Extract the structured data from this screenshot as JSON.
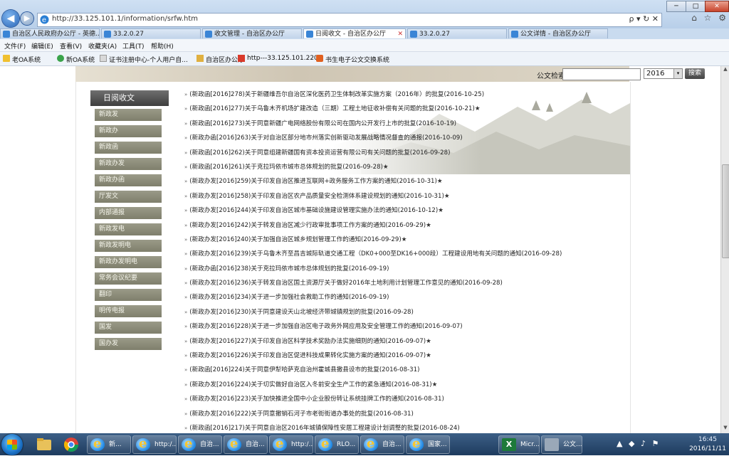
{
  "browser": {
    "address": "http://33.125.101.1/information/srfw.htm",
    "search_glyph": "ρ",
    "dropdown_glyph": "▾",
    "refresh_glyph": "↻",
    "stop_glyph": "✕",
    "back_glyph": "◀",
    "forward_glyph": "▶",
    "win_min": "─",
    "win_max": "□",
    "win_close": "✕",
    "icons": {
      "home": "⌂",
      "favorites": "☆",
      "tools": "⚙"
    }
  },
  "tabs": [
    {
      "label": "自治区人民政府办公厅 - 英德..."
    },
    {
      "label": "33.2.0.27"
    },
    {
      "label": "收文管理 - 自治区办公厅"
    },
    {
      "label": "日阅收文 - 自治区办公厅",
      "close": "✕"
    },
    {
      "label": "33.2.0.27"
    },
    {
      "label": "公文详情 - 自治区办公厅"
    }
  ],
  "menu": [
    {
      "label": "文件(F)"
    },
    {
      "label": "编辑(E)"
    },
    {
      "label": "查看(V)"
    },
    {
      "label": "收藏夹(A)"
    },
    {
      "label": "工具(T)"
    },
    {
      "label": "帮助(H)"
    }
  ],
  "favorites": [
    {
      "label": "老OA系统"
    },
    {
      "label": "新OA系统"
    },
    {
      "label": "证书注册中心-个人用户自..."
    },
    {
      "label": "自治区办公厅"
    },
    {
      "label": "http---33.125.101.220-"
    },
    {
      "label": "书生电子公文交换系统"
    }
  ],
  "search": {
    "label": "公文检索:",
    "value": "",
    "year": "2016",
    "button": "搜索"
  },
  "leftnav": {
    "header": "日阅收文",
    "items": [
      {
        "label": "新政发"
      },
      {
        "label": "新政办"
      },
      {
        "label": "新政函"
      },
      {
        "label": "新政办发"
      },
      {
        "label": "新政办函"
      },
      {
        "label": "厅发文"
      },
      {
        "label": "内部通报"
      },
      {
        "label": "新政发电"
      },
      {
        "label": "新政发明电"
      },
      {
        "label": "新政办发明电"
      },
      {
        "label": "常务会议纪要"
      },
      {
        "label": "翻印"
      },
      {
        "label": "明传电报"
      },
      {
        "label": "国发"
      },
      {
        "label": "国办发"
      }
    ]
  },
  "documents": [
    {
      "text": "(新政函[2016]278)关于新疆维吾尔自治区深化医药卫生体制改革实施方案（2016年）的批复(2016-10-25)",
      "star": ""
    },
    {
      "text": "(新政函[2016]277)关于乌鲁木齐机场扩建改造（三期）工程土地征收补偿有关问题的批复(2016-10-21)",
      "star": "★"
    },
    {
      "text": "(新政函[2016]273)关于同意新疆广电网络股份有限公司在国内公开发行上市的批复(2016-10-19)",
      "star": ""
    },
    {
      "text": "(新政办函[2016]263)关于对自治区部分地市州落实创新驱动发展战略情况督查的通报(2016-10-09)",
      "star": ""
    },
    {
      "text": "(新政函[2016]262)关于同意组建新疆国有资本投资运营有限公司有关问题的批复(2016-09-28)",
      "star": ""
    },
    {
      "text": "(新政函[2016]261)关于克拉玛依市城市总体规划的批复(2016-09-28)",
      "star": "★"
    },
    {
      "text": "(新政办发[2016]259)关于印发自治区推进互联网+政务服务工作方案的通知(2016-10-31)",
      "star": "★"
    },
    {
      "text": "(新政办发[2016]258)关于印发自治区农产品质量安全检测体系建设规划的通知(2016-10-31)",
      "star": "★"
    },
    {
      "text": "(新政办发[2016]244)关于印发自治区城市基础设施建设管理实施办法的通知(2016-10-12)",
      "star": "★"
    },
    {
      "text": "(新政办发[2016]242)关于转发自治区减少行政审批事项工作方案的通知(2016-09-29)",
      "star": "★"
    },
    {
      "text": "(新政办发[2016]240)关于加强自治区城乡规划管理工作的通知(2016-09-29)",
      "star": "★"
    },
    {
      "text": "(新政办发[2016]239)关于乌鲁木齐至昌吉城际轨道交通工程（DK0+000至DK16+000段）工程建设用地有关问题的通知(2016-09-28)",
      "star": ""
    },
    {
      "text": "(新政办函[2016]238)关于克拉玛依市城市总体规划的批复(2016-09-19)",
      "star": ""
    },
    {
      "text": "(新政办发[2016]236)关于转发自治区国土资源厅关于做好2016年土地利用计划管理工作意见的通知(2016-09-28)",
      "star": ""
    },
    {
      "text": "(新政办发[2016]234)关于进一步加强社会救助工作的通知(2016-09-19)",
      "star": ""
    },
    {
      "text": "(新政办发[2016]230)关于同意建设天山北坡经济带城镇规划的批复(2016-09-28)",
      "star": ""
    },
    {
      "text": "(新政办发[2016]228)关于进一步加强自治区电子政务外网应用及安全管理工作的通知(2016-09-07)",
      "star": ""
    },
    {
      "text": "(新政办发[2016]227)关于印发自治区科学技术奖励办法实施细则的通知(2016-09-07)",
      "star": "★"
    },
    {
      "text": "(新政办发[2016]226)关于印发自治区促进科技成果转化实施方案的通知(2016-09-07)",
      "star": "★"
    },
    {
      "text": "(新政函[2016]224)关于同意伊犁哈萨克自治州霍城县撤县设市的批复(2016-08-31)",
      "star": ""
    },
    {
      "text": "(新政办发[2016]224)关于切实做好自治区入冬前安全生产工作的紧急通知(2016-08-31)",
      "star": "★"
    },
    {
      "text": "(新政办发[2016]223)关于加快推进全国中小企业股份转让系统挂牌工作的通知(2016-08-31)",
      "star": ""
    },
    {
      "text": "(新政办发[2016]222)关于同意撤销石河子市老街街道办事处的批复(2016-08-31)",
      "star": ""
    },
    {
      "text": "(新政函[2016]217)关于同意自治区2016年城镇保障性安居工程建设计划调整的批复(2016-08-24)",
      "star": ""
    }
  ],
  "taskbar": {
    "tasks": [
      {
        "label": "新..."
      },
      {
        "label": "http:/..."
      },
      {
        "label": "自治..."
      },
      {
        "label": "自治..."
      },
      {
        "label": "http:/..."
      },
      {
        "label": "RLO..."
      },
      {
        "label": "自治..."
      },
      {
        "label": "国家..."
      },
      {
        "label": "Micr..."
      },
      {
        "label": "公文..."
      }
    ],
    "tray": {
      "time": "16:45",
      "date": "2016/11/11"
    }
  },
  "colors": {
    "nav_item": "#8d8d7a",
    "header": "#555555",
    "chrome": "#c9dbef",
    "taskbar": "#2b4a70"
  }
}
